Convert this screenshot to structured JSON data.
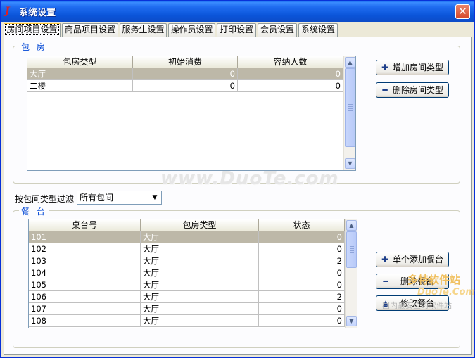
{
  "window": {
    "title": "系统设置",
    "close_symbol": "✕"
  },
  "tabs": [
    {
      "label": "房间项目设置",
      "active": true
    },
    {
      "label": "商品项目设置",
      "active": false
    },
    {
      "label": "服务生设置",
      "active": false
    },
    {
      "label": "操作员设置",
      "active": false
    },
    {
      "label": "打印设置",
      "active": false
    },
    {
      "label": "会员设置",
      "active": false
    },
    {
      "label": "系统设置",
      "active": false
    }
  ],
  "rooms_group": {
    "legend": "包 房",
    "columns": [
      "包房类型",
      "初始消费",
      "容纳人数"
    ],
    "rows": [
      {
        "type": "大厅",
        "min_spend": "0",
        "capacity": "0",
        "selected": true
      },
      {
        "type": "二楼",
        "min_spend": "0",
        "capacity": "0",
        "selected": false
      }
    ],
    "add_button": "增加房间类型",
    "delete_button": "删除房间类型"
  },
  "filter": {
    "label": "按包间类型过滤",
    "value": "所有包间"
  },
  "tables_group": {
    "legend": "餐 台",
    "columns": [
      "桌台号",
      "包房类型",
      "状态"
    ],
    "rows": [
      {
        "no": "101",
        "room": "大厅",
        "status": "0",
        "selected": true
      },
      {
        "no": "102",
        "room": "大厅",
        "status": "0",
        "selected": false
      },
      {
        "no": "103",
        "room": "大厅",
        "status": "2",
        "selected": false
      },
      {
        "no": "104",
        "room": "大厅",
        "status": "0",
        "selected": false
      },
      {
        "no": "105",
        "room": "大厅",
        "status": "0",
        "selected": false
      },
      {
        "no": "106",
        "room": "大厅",
        "status": "2",
        "selected": false
      },
      {
        "no": "107",
        "room": "大厅",
        "status": "0",
        "selected": false
      },
      {
        "no": "108",
        "room": "大厅",
        "status": "0",
        "selected": false
      }
    ],
    "add_button": "单个添加餐台",
    "delete_button": "删除餐台",
    "edit_button": "修改餐台"
  },
  "watermarks": {
    "center": "www.DuoTe.com",
    "site_name": "多特软件站",
    "domain": "DuoTe.Com",
    "slogan": "国内最安全的软件站"
  },
  "colors": {
    "title_bar": "#0B55D9",
    "selection": "#BDB8A8",
    "legend": "#0046D5"
  }
}
